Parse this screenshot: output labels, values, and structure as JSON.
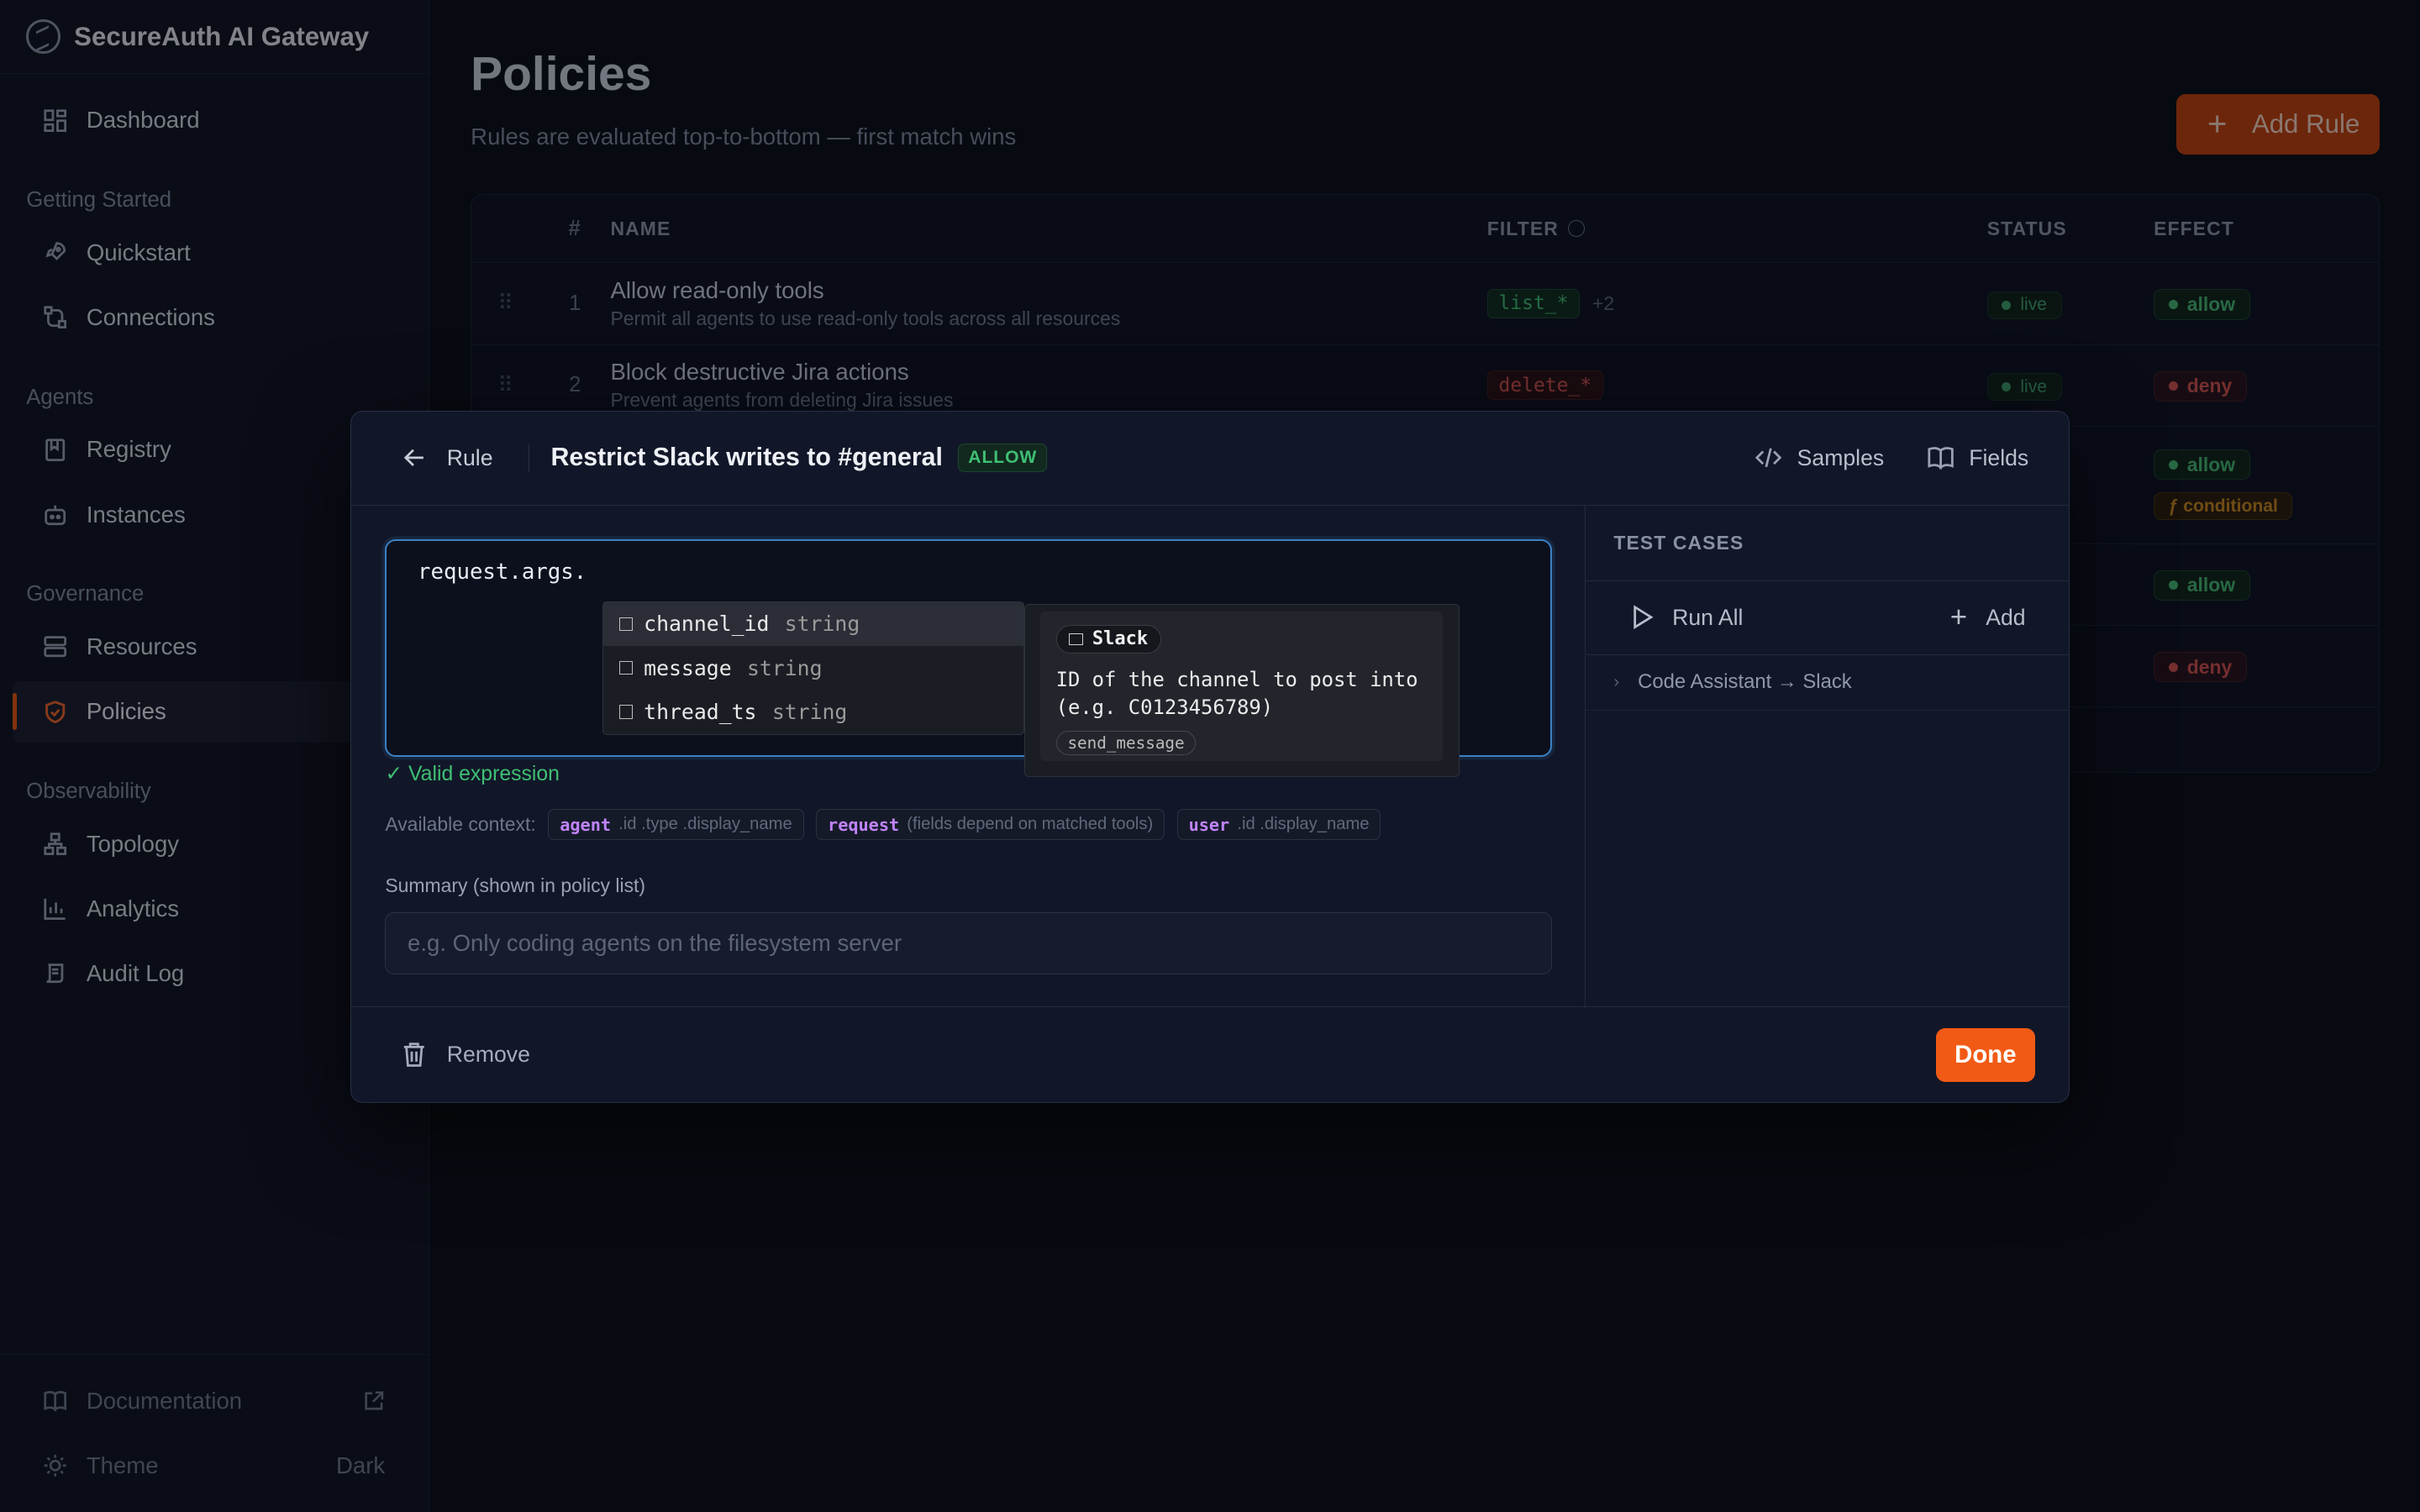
{
  "brand": {
    "title": "SecureAuth AI Gateway"
  },
  "sidebar": {
    "top_items": [
      {
        "label": "Dashboard",
        "icon": "dashboard-icon"
      }
    ],
    "sections": [
      {
        "title": "Getting Started",
        "items": [
          {
            "label": "Quickstart",
            "icon": "rocket-icon"
          },
          {
            "label": "Connections",
            "icon": "connections-icon"
          }
        ]
      },
      {
        "title": "Agents",
        "items": [
          {
            "label": "Registry",
            "icon": "book-icon"
          },
          {
            "label": "Instances",
            "icon": "bot-icon"
          }
        ]
      },
      {
        "title": "Governance",
        "items": [
          {
            "label": "Resources",
            "icon": "server-icon"
          },
          {
            "label": "Policies",
            "icon": "shield-icon",
            "active": true
          }
        ]
      },
      {
        "title": "Observability",
        "items": [
          {
            "label": "Topology",
            "icon": "topology-icon"
          },
          {
            "label": "Analytics",
            "icon": "chart-icon"
          },
          {
            "label": "Audit Log",
            "icon": "scroll-icon"
          }
        ]
      }
    ],
    "bottom": {
      "documentation": "Documentation",
      "theme_label": "Theme",
      "theme_value": "Dark"
    }
  },
  "page": {
    "title": "Policies",
    "subtitle": "Rules are evaluated top-to-bottom — first match wins",
    "add_rule": "Add Rule"
  },
  "table": {
    "headers": {
      "num": "#",
      "name": "NAME",
      "filter": "FILTER",
      "status": "STATUS",
      "effect": "EFFECT"
    },
    "rows": [
      {
        "num": "1",
        "name": "Allow read-only tools",
        "desc": "Permit all agents to use read-only tools across all resources",
        "filter": "list_*",
        "more": "+2",
        "status": "live",
        "effect": "allow"
      },
      {
        "num": "2",
        "name": "Block destructive Jira actions",
        "desc": "Prevent agents from deleting Jira issues",
        "filter": "delete_*",
        "status": "live",
        "effect": "deny"
      },
      {
        "effect": "allow",
        "conditional": "ƒ conditional"
      },
      {
        "effect": "allow"
      },
      {
        "effect": "deny"
      }
    ]
  },
  "modal": {
    "back_label": "Rule",
    "title": "Restrict Slack writes to #general",
    "badge": "ALLOW",
    "samples": "Samples",
    "fields": "Fields",
    "editor_text": "request.args.",
    "autocomplete": [
      {
        "name": "channel_id",
        "type": "string"
      },
      {
        "name": "message",
        "type": "string"
      },
      {
        "name": "thread_ts",
        "type": "string"
      }
    ],
    "doc": {
      "service": "Slack",
      "text": "ID of the channel to post into (e.g. C0123456789)",
      "tag": "send_message"
    },
    "valid": "✓ Valid expression",
    "context_label": "Available context:",
    "context": [
      {
        "key": "agent",
        "rest": ".id .type .display_name"
      },
      {
        "key": "request",
        "rest": "(fields depend on matched tools)"
      },
      {
        "key": "user",
        "rest": ".id .display_name"
      }
    ],
    "summary_label": "Summary (shown in policy list)",
    "summary_placeholder": "e.g. Only coding agents on the filesystem server",
    "test_cases_title": "TEST CASES",
    "run_all": "Run All",
    "add": "Add",
    "test_case": "Code Assistant → Slack",
    "remove": "Remove",
    "done": "Done"
  },
  "colors": {
    "accent": "#f15a15",
    "allow": "#3fbf74",
    "deny": "#d0504b",
    "focus": "#3b82c4"
  }
}
